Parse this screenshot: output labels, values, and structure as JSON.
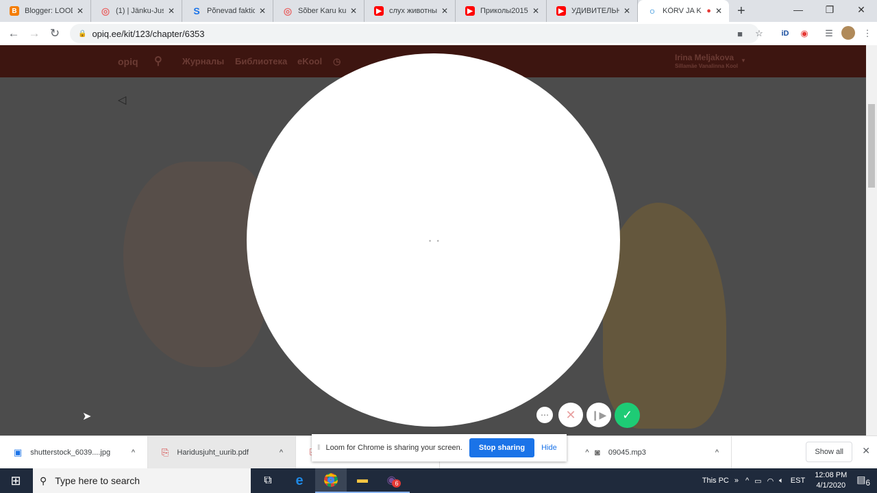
{
  "browser": {
    "tabs": [
      {
        "title": "Blogger: LOOD",
        "icon": "blogger-icon",
        "color": "#f57d00"
      },
      {
        "title": "(1) | Jänku-Juss",
        "icon": "opiq-swirl-icon",
        "color": "#e86b6b"
      },
      {
        "title": "Põnevad faktid",
        "icon": "s-logo-icon",
        "color": "#1a73e8"
      },
      {
        "title": "Sõber Karu ku",
        "icon": "opiq-swirl-icon",
        "color": "#e86b6b"
      },
      {
        "title": "слух животны",
        "icon": "youtube-icon",
        "color": "#ff0000"
      },
      {
        "title": "Приколы2015",
        "icon": "youtube-icon",
        "color": "#ff0000"
      },
      {
        "title": "УДИВИТЕЛЬН",
        "icon": "youtube-icon",
        "color": "#ff0000"
      },
      {
        "title": "KÕRV JA K",
        "icon": "loom-icon",
        "color": "#0078d4",
        "active": true,
        "recording": true
      }
    ],
    "url": "opiq.ee/kit/123/chapter/6353"
  },
  "site": {
    "logo": "opiq",
    "nav": [
      "Журналы",
      "Библиотека",
      "eKool"
    ],
    "user_name": "Irina Meljakova",
    "user_school": "Sillamäe Vanalinna Kool"
  },
  "loom": {
    "loading": "• •",
    "controls": [
      "more-icon",
      "cancel-icon",
      "pause-resume-icon",
      "done-check-icon"
    ],
    "accent": "#1ecb75",
    "banner_text": "Loom for Chrome is sharing your screen.",
    "stop_label": "Stop sharing",
    "hide_label": "Hide"
  },
  "downloads": {
    "items": [
      {
        "name": "shutterstock_6039....jpg",
        "icon": "image-file-icon"
      },
      {
        "name": "Haridusjuht_uurib.pdf",
        "icon": "pdf-file-icon"
      },
      {
        "name": "",
        "icon": "pdf-file-icon"
      },
      {
        "name": "09045.mp3",
        "icon": "audio-file-icon"
      }
    ],
    "show_all": "Show all"
  },
  "taskbar": {
    "search_placeholder": "Type here to search",
    "this_pc": "This PC",
    "lang": "EST",
    "time": "12:08 PM",
    "date": "4/1/2020",
    "viber_badge": "6",
    "notif_count": "6"
  }
}
